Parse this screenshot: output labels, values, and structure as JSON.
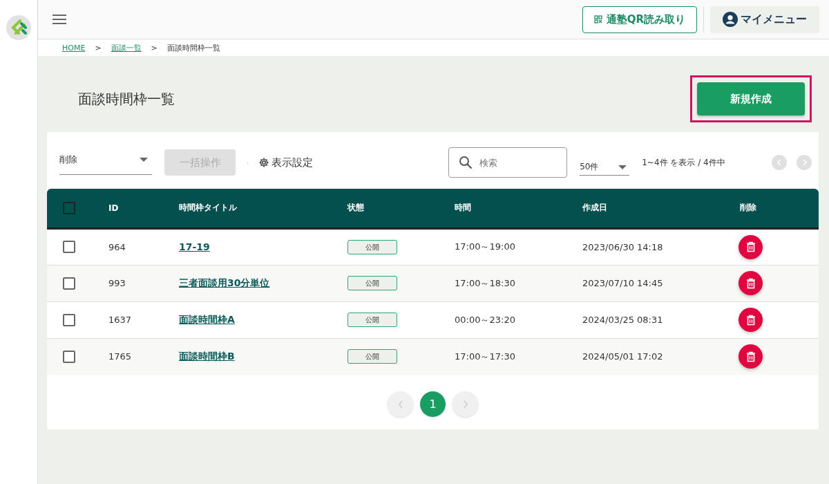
{
  "header": {
    "qr_button": "通塾QR読み取り",
    "my_menu": "マイメニュー"
  },
  "breadcrumb": [
    {
      "label": "HOME",
      "link": true
    },
    {
      "label": "面談一覧",
      "link": true
    },
    {
      "label": "面談時間枠一覧",
      "link": false
    }
  ],
  "breadcrumb_separator": ">",
  "page_title": "面談時間枠一覧",
  "new_button": {
    "label": "新規作成",
    "highlighted": true
  },
  "toolbar": {
    "action_select": "削除",
    "bulk_button": {
      "label": "一括操作",
      "disabled": true
    },
    "separator": "·",
    "display_settings": "表示設定",
    "search": {
      "placeholder": "検索"
    },
    "per_page": "50件",
    "range": "1~4件 を表示 / 4件中",
    "prev_disabled": true,
    "next_disabled": true
  },
  "table": {
    "header_checked": false,
    "columns": [
      "ID",
      "時間枠タイトル",
      "状態",
      "時間",
      "作成日",
      "削除"
    ],
    "rows": [
      {
        "checked": false,
        "id": "964",
        "title": "17-19",
        "status": "公開",
        "time": "17:00～19:00",
        "created": "2023/06/30 14:18"
      },
      {
        "checked": false,
        "id": "993",
        "title": "三者面談用30分単位",
        "status": "公開",
        "time": "17:00～18:30",
        "created": "2023/07/10 14:45"
      },
      {
        "checked": false,
        "id": "1637",
        "title": "面談時間枠A",
        "status": "公開",
        "time": "00:00～23:20",
        "created": "2024/03/25 08:31"
      },
      {
        "checked": false,
        "id": "1765",
        "title": "面談時間枠B",
        "status": "公開",
        "time": "17:00～17:30",
        "created": "2024/05/01 17:02"
      }
    ]
  },
  "pagination": {
    "prev_disabled": true,
    "next_disabled": true,
    "pages": [
      {
        "label": "1",
        "selected": true
      }
    ]
  }
}
